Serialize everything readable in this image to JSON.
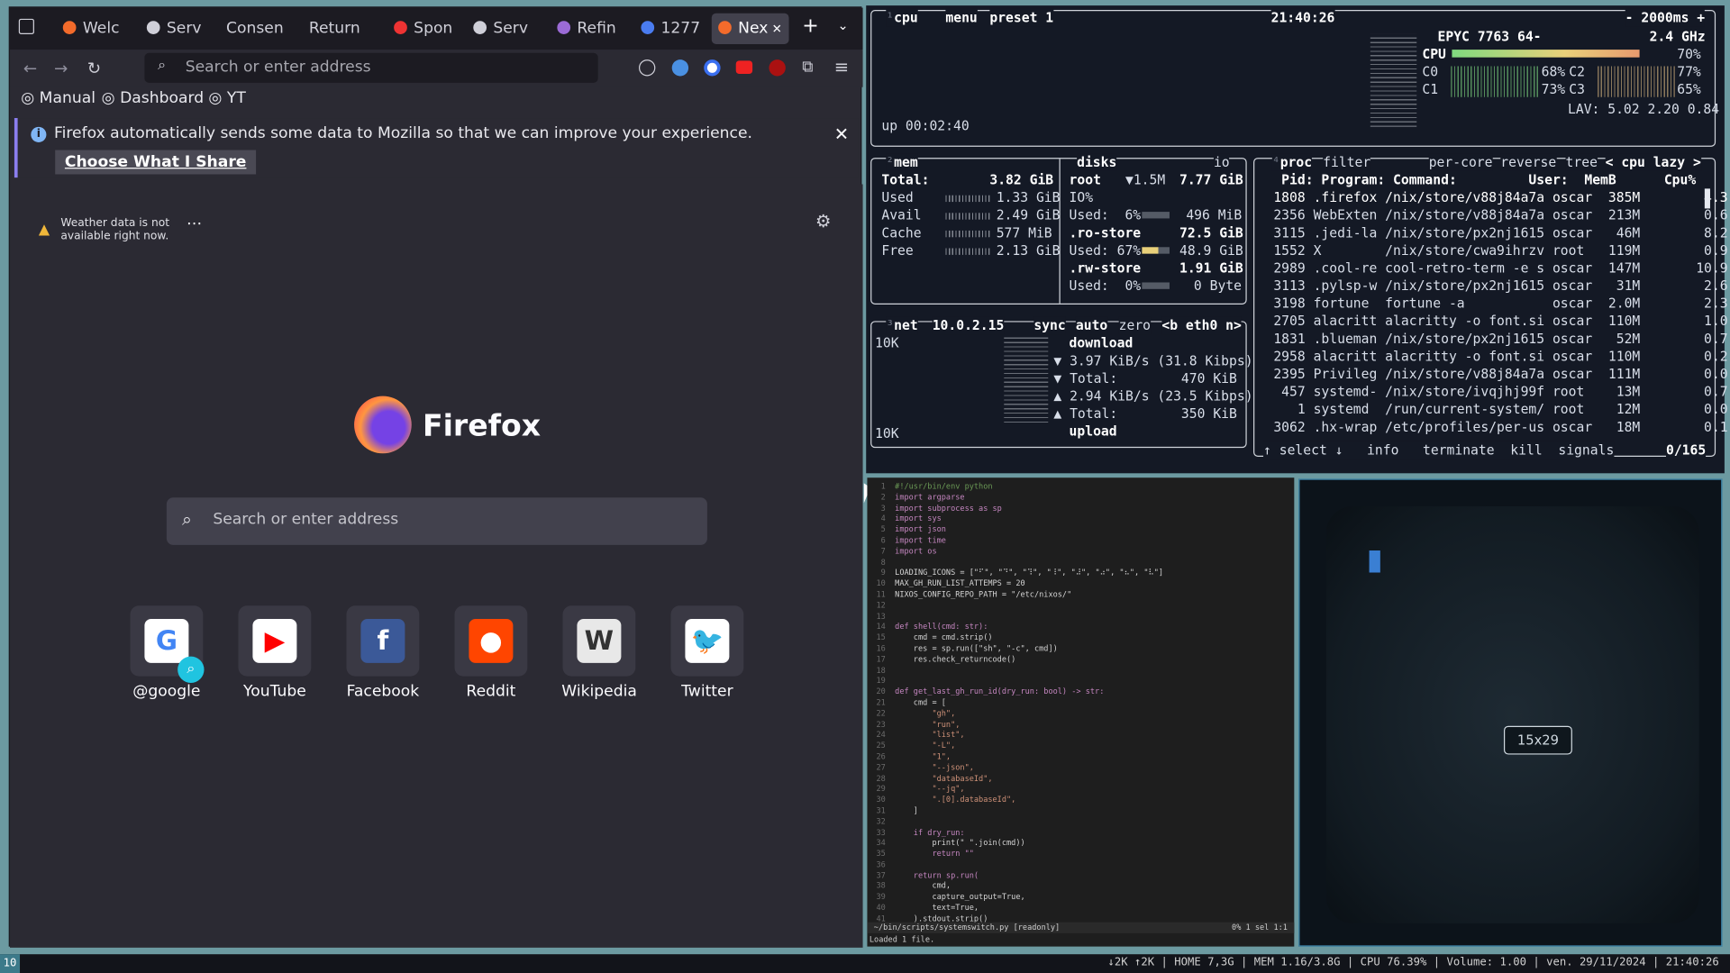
{
  "firefox": {
    "tabs": [
      {
        "label": "Welc",
        "color": "#f36b2b"
      },
      {
        "label": "Serv",
        "color": "#cfcfd8"
      },
      {
        "label": "Consen",
        "color": ""
      },
      {
        "label": "Return",
        "color": ""
      },
      {
        "label": "Spon",
        "color": "#e33"
      },
      {
        "label": "Serv",
        "color": "#cfcfd8"
      },
      {
        "label": "Refin",
        "color": "#9b6bd6"
      },
      {
        "label": "1277",
        "color": "#4a7cf0"
      },
      {
        "label": "Nex",
        "color": "#f36b2b"
      }
    ],
    "url_placeholder": "Search or enter address",
    "bookmarks": [
      "Manual",
      "Dashboard",
      "YT"
    ],
    "notice_text": "Firefox automatically sends some data to Mozilla so that we can improve your experience.",
    "notice_button": "Choose What I Share",
    "weather_text": "Weather data is not available right now.",
    "logo_text": "Firefox",
    "search_placeholder": "Search or enter address",
    "sites": [
      {
        "label": "@google",
        "icon": "G",
        "color": "#ffffff",
        "fg": "#4285f4"
      },
      {
        "label": "YouTube",
        "icon": "▶",
        "color": "#ffffff",
        "fg": "#ff0000"
      },
      {
        "label": "Facebook",
        "icon": "f",
        "color": "#3b5998",
        "fg": "#ffffff"
      },
      {
        "label": "Reddit",
        "icon": "●",
        "color": "#ff4500",
        "fg": "#ffffff"
      },
      {
        "label": "Wikipedia",
        "icon": "W",
        "color": "#e8e8e8",
        "fg": "#333"
      },
      {
        "label": "Twitter",
        "icon": "🐦",
        "color": "#ffffff",
        "fg": "#1da1f2"
      }
    ]
  },
  "btop": {
    "cpu_header": "cpu",
    "menu": "menu",
    "preset": "preset 1",
    "time": "21:40:26",
    "interval": "- 2000ms +",
    "cpu_name": "EPYC 7763 64-",
    "cpu_freq": "2.4 GHz",
    "cpu_total_label": "CPU",
    "cpu_total": "70%",
    "cores": [
      {
        "name": "C0",
        "pct": "68%"
      },
      {
        "name": "C1",
        "pct": "73%"
      },
      {
        "name": "C2",
        "pct": "77%"
      },
      {
        "name": "C3",
        "pct": "65%"
      }
    ],
    "lav": "LAV: 5.02 2.20 0.84",
    "uptime": "up 00:02:40",
    "mem": {
      "title": "mem",
      "total": "3.82 GiB",
      "rows": [
        {
          "label": "Used",
          "val": "1.33 GiB"
        },
        {
          "label": "Avail",
          "val": "2.49 GiB"
        },
        {
          "label": "Cache",
          "val": "577 MiB"
        },
        {
          "label": "Free",
          "val": "2.13 GiB"
        }
      ]
    },
    "disks": {
      "title": "disks",
      "io": "io",
      "root": "root",
      "root_io": "▼1.5M",
      "root_total": "7.77 GiB",
      "io_label": "IO%",
      "root_used": "Used:  6%",
      "root_used_val": "496 MiB",
      "ro": ".ro-store",
      "ro_total": "72.5 GiB",
      "ro_used": "Used: 67%",
      "ro_used_val": "48.9 GiB",
      "rw": ".rw-store",
      "rw_total": "1.91 GiB",
      "rw_used": "Used:  0%",
      "rw_used_val": "0 Byte"
    },
    "net": {
      "title": "net",
      "ip": "10.0.2.15",
      "sync": "sync",
      "auto": "auto",
      "zero": "zero",
      "iface": "<b eth0 n>",
      "scale_top": "10K",
      "scale_bottom": "10K",
      "download": "download",
      "dl_rate": "▼ 3.97 KiB/s (31.8 Kibps)",
      "dl_total": "▼ Total:        470 KiB",
      "ul_rate": "▲ 2.94 KiB/s (23.5 Kibps)",
      "ul_total": "▲ Total:        350 KiB",
      "upload": "upload"
    },
    "proc": {
      "title": "proc",
      "filter": "filter",
      "per_core": "per-core",
      "reverse": "reverse",
      "tree": "tree",
      "sort": "< cpu lazy >",
      "header": "  Pid: Program: Command:         User:  MemB      Cpu%",
      "rows": [
        " 1808 .firefox /nix/store/v88j84a7a oscar  385M        4.3",
        " 2356 WebExten /nix/store/v88j84a7a oscar  213M        0.6",
        " 3115 .jedi-la /nix/store/px2nj1615 oscar   46M        8.2",
        " 1552 X        /nix/store/cwa9ihrzv root   119M        0.9",
        " 2989 .cool-re cool-retro-term -e s oscar  147M       10.9",
        " 3113 .pylsp-w /nix/store/px2nj1615 oscar   31M        2.6",
        " 3198 fortune  fortune -a           oscar  2.0M        2.3",
        " 2705 alacritt alacritty -o font.si oscar  110M        1.0",
        " 1831 .blueman /nix/store/px2nj1615 oscar   52M        0.7",
        " 2958 alacritt alacritty -o font.si oscar  110M        0.2",
        " 2395 Privileg /nix/store/v88j84a7a oscar  111M        0.0",
        "  457 systemd- /nix/store/ivqjhj99f root    13M        0.7",
        "    1 systemd  /run/current-system/ root    12M        0.0",
        " 3062 .hx-wrap /etc/profiles/per-us oscar   18M        0.1"
      ],
      "footer": "↑ select ↓   info   terminate  kill  signals",
      "count": "0/165"
    }
  },
  "editor": {
    "lines": [
      "#!/usr/bin/env python",
      "import argparse",
      "import subprocess as sp",
      "import sys",
      "import json",
      "import time",
      "import os",
      "",
      "LOADING_ICONS = [\"⠋\", \"⠙\", \"⠹\", \"⠸\", \"⠼\", \"⠴\", \"⠦\", \"⠧\"]",
      "MAX_GH_RUN_LIST_ATTEMPS = 20",
      "NIXOS_CONFIG_REPO_PATH = \"/etc/nixos/\"",
      "",
      "",
      "def shell(cmd: str):",
      "    cmd = cmd.strip()",
      "    res = sp.run([\"sh\", \"-c\", cmd])",
      "    res.check_returncode()",
      "",
      "",
      "def get_last_gh_run_id(dry_run: bool) -> str:",
      "    cmd = [",
      "        \"gh\",",
      "        \"run\",",
      "        \"list\",",
      "        \"-L\",",
      "        \"1\",",
      "        \"--json\",",
      "        \"databaseId\",",
      "        \"--jq\",",
      "        \".[0].databaseId\",",
      "    ]",
      "",
      "    if dry_run:",
      "        print(\" \".join(cmd))",
      "        return \"\"",
      "",
      "    return sp.run(",
      "        cmd,",
      "        capture_output=True,",
      "        text=True,",
      "    ).stdout.strip()"
    ],
    "status_path": "~/bin/scripts/systemswitch.py  [readonly]",
    "status_right": "0%   1 sel  1:1",
    "message": "Loaded 1 file."
  },
  "retro": {
    "size": "15x29"
  },
  "bar": {
    "workspace": "10",
    "status": "↓2K ↑2K | HOME 7,3G | MEM 1.16/3.8G | CPU 76.39% | Volume: 1.00 | ven. 29/11/2024 | 21:40:26"
  }
}
